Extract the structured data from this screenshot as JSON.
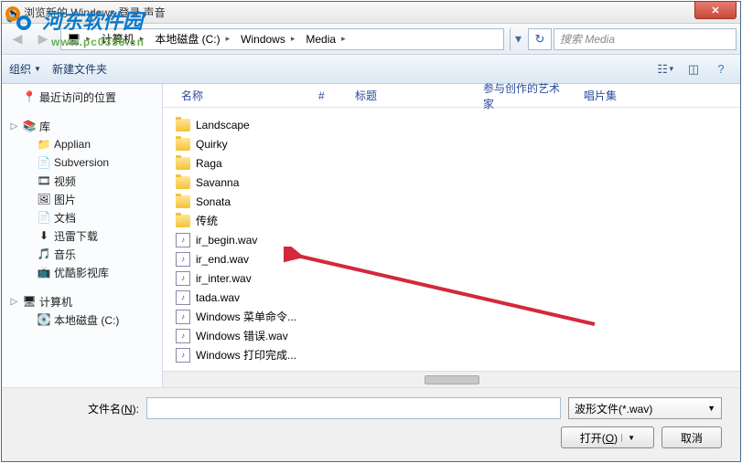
{
  "window": {
    "title": "浏览新的 Windows 登录  声音"
  },
  "watermark": {
    "text": "河东软件园",
    "url": "www.pc0359.cn"
  },
  "nav": {
    "breadcrumbs": [
      "计算机",
      "本地磁盘 (C:)",
      "Windows",
      "Media"
    ],
    "search_placeholder": "搜索 Media"
  },
  "toolbar": {
    "organize": "组织",
    "new_folder": "新建文件夹"
  },
  "sidebar": {
    "recent": "最近访问的位置",
    "library": "库",
    "lib_items": [
      "Applian",
      "Subversion",
      "视频",
      "图片",
      "文档",
      "迅雷下载",
      "音乐",
      "优酷影视库"
    ],
    "computer": "计算机",
    "local_disk": "本地磁盘 (C:)"
  },
  "columns": {
    "name": "名称",
    "num": "#",
    "title": "标题",
    "artist": "参与创作的艺术家",
    "album": "唱片集"
  },
  "files": {
    "folders": [
      "Landscape",
      "Quirky",
      "Raga",
      "Savanna",
      "Sonata",
      "传统"
    ],
    "wavs": [
      "ir_begin.wav",
      "ir_end.wav",
      "ir_inter.wav",
      "tada.wav",
      "Windows 菜单命令...",
      "Windows 错误.wav",
      "Windows 打印完成..."
    ]
  },
  "footer": {
    "filename_label": "文件名(N):",
    "filter": "波形文件(*.wav)",
    "open": "打开(O)",
    "cancel": "取消"
  }
}
